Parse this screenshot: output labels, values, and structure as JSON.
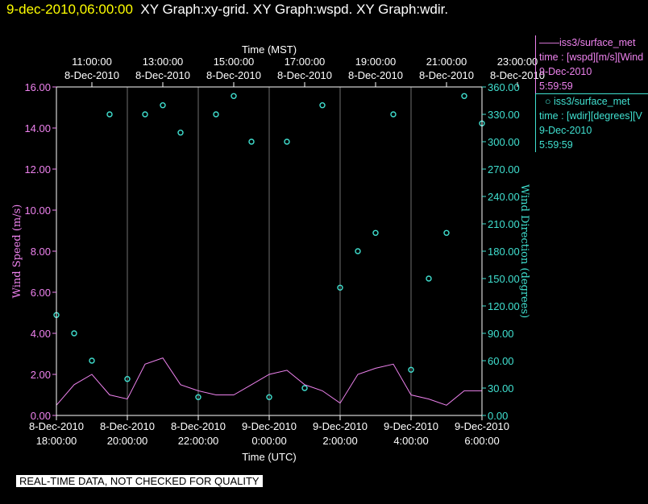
{
  "header": {
    "timestamp": "9-dec-2010,06:00:00",
    "graphs": "XY Graph:xy-grid.  XY Graph:wspd.  XY Graph:wdir."
  },
  "legend": {
    "wspd": {
      "name": "iss3/surface_met",
      "desc": "time : [wspd][m/s][Wind",
      "date": "9-Dec-2010",
      "time": "5:59:59",
      "color": "#ee82ee"
    },
    "wdir": {
      "name": "iss3/surface_met",
      "desc": "time : [wdir][degrees][V",
      "date": "9-Dec-2010",
      "time": "5:59:59",
      "color": "#40e0d0"
    }
  },
  "notice": "REAL-TIME DATA, NOT CHECKED FOR QUALITY",
  "chart_data": {
    "type": "scatter",
    "top_axis_label": "Time (MST)",
    "top_ticks": [
      {
        "time": "11:00:00",
        "date": "8-Dec-2010"
      },
      {
        "time": "13:00:00",
        "date": "8-Dec-2010"
      },
      {
        "time": "15:00:00",
        "date": "8-Dec-2010"
      },
      {
        "time": "17:00:00",
        "date": "8-Dec-2010"
      },
      {
        "time": "19:00:00",
        "date": "8-Dec-2010"
      },
      {
        "time": "21:00:00",
        "date": "8-Dec-2010"
      },
      {
        "time": "23:00:00",
        "date": "8-Dec-2010"
      }
    ],
    "xlabel": "Time (UTC)",
    "bottom_ticks": [
      {
        "date": "8-Dec-2010",
        "time": "18:00:00"
      },
      {
        "date": "8-Dec-2010",
        "time": "20:00:00"
      },
      {
        "date": "8-Dec-2010",
        "time": "22:00:00"
      },
      {
        "date": "9-Dec-2010",
        "time": "0:00:00"
      },
      {
        "date": "9-Dec-2010",
        "time": "2:00:00"
      },
      {
        "date": "9-Dec-2010",
        "time": "4:00:00"
      },
      {
        "date": "9-Dec-2010",
        "time": "6:00:00"
      }
    ],
    "xlim_utc": [
      "2010-12-08 18:00:00",
      "2010-12-09 06:00:00"
    ],
    "ylabel_left": "Wind Speed (m/s)",
    "ylabel_right": "Wind Direction (degrees)",
    "ylim_left": [
      0,
      16
    ],
    "ylim_right": [
      0,
      360
    ],
    "yticks_left": [
      "0.00",
      "2.00",
      "4.00",
      "6.00",
      "8.00",
      "10.00",
      "12.00",
      "14.00",
      "16.00"
    ],
    "yticks_right": [
      "0.00",
      "30.00",
      "60.00",
      "90.00",
      "120.00",
      "150.00",
      "180.00",
      "210.00",
      "240.00",
      "270.00",
      "300.00",
      "330.00",
      "360.00"
    ],
    "grid": "vertical",
    "series": [
      {
        "name": "wspd",
        "style": "line",
        "color": "#ee82ee",
        "x": [
          "18:00",
          "18:30",
          "19:00",
          "19:30",
          "20:00",
          "20:30",
          "21:00",
          "21:30",
          "22:00",
          "22:30",
          "23:00",
          "23:30",
          "0:00",
          "0:30",
          "1:00",
          "1:30",
          "2:00",
          "2:30",
          "3:00",
          "3:30",
          "4:00",
          "4:30",
          "5:00",
          "5:30",
          "6:00"
        ],
        "y": [
          0.5,
          1.5,
          2.0,
          1.0,
          0.8,
          2.5,
          2.8,
          1.5,
          1.2,
          1.0,
          1.0,
          1.5,
          2.0,
          2.2,
          1.5,
          1.2,
          0.6,
          2.0,
          2.3,
          2.5,
          1.0,
          0.8,
          0.5,
          1.2,
          1.2
        ]
      },
      {
        "name": "wdir",
        "style": "points",
        "color": "#40e0d0",
        "x": [
          "18:00",
          "18:30",
          "19:00",
          "19:30",
          "20:00",
          "20:30",
          "21:00",
          "21:30",
          "22:00",
          "22:30",
          "23:00",
          "23:30",
          "0:00",
          "0:30",
          "1:00",
          "1:30",
          "2:00",
          "2:30",
          "3:00",
          "3:30",
          "4:00",
          "4:30",
          "5:00",
          "5:30",
          "6:00"
        ],
        "y": [
          110,
          90,
          60,
          330,
          40,
          330,
          340,
          310,
          20,
          330,
          350,
          300,
          20,
          300,
          30,
          340,
          140,
          180,
          200,
          330,
          50,
          150,
          200,
          350,
          320
        ]
      }
    ]
  }
}
